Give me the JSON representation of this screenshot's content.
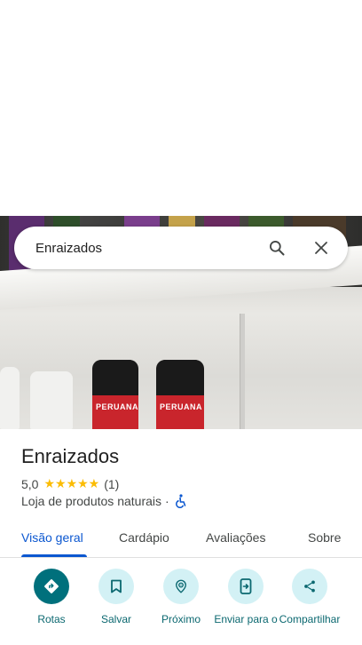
{
  "search": {
    "query": "Enraizados"
  },
  "photo": {
    "product_label": "PERUANA"
  },
  "place": {
    "name": "Enraizados",
    "rating": "5,0",
    "stars": "★★★★★",
    "review_count": "(1)",
    "category": "Loja de produtos naturais",
    "separator": "·"
  },
  "tabs": [
    {
      "label": "Visão geral",
      "active": true
    },
    {
      "label": "Cardápio",
      "active": false
    },
    {
      "label": "Avaliações",
      "active": false
    },
    {
      "label": "Sobre",
      "active": false
    }
  ],
  "actions": [
    {
      "label": "Rotas",
      "icon": "directions-icon"
    },
    {
      "label": "Salvar",
      "icon": "bookmark-icon"
    },
    {
      "label": "Próximo",
      "icon": "nearby-icon"
    },
    {
      "label": "Enviar para o",
      "icon": "send-to-phone-icon"
    },
    {
      "label": "Compartilhar",
      "icon": "share-icon"
    }
  ],
  "colors": {
    "accent": "#0b57d0",
    "action_primary": "#00707c",
    "action_bg": "#d3f1f5",
    "star": "#fbbc04"
  }
}
